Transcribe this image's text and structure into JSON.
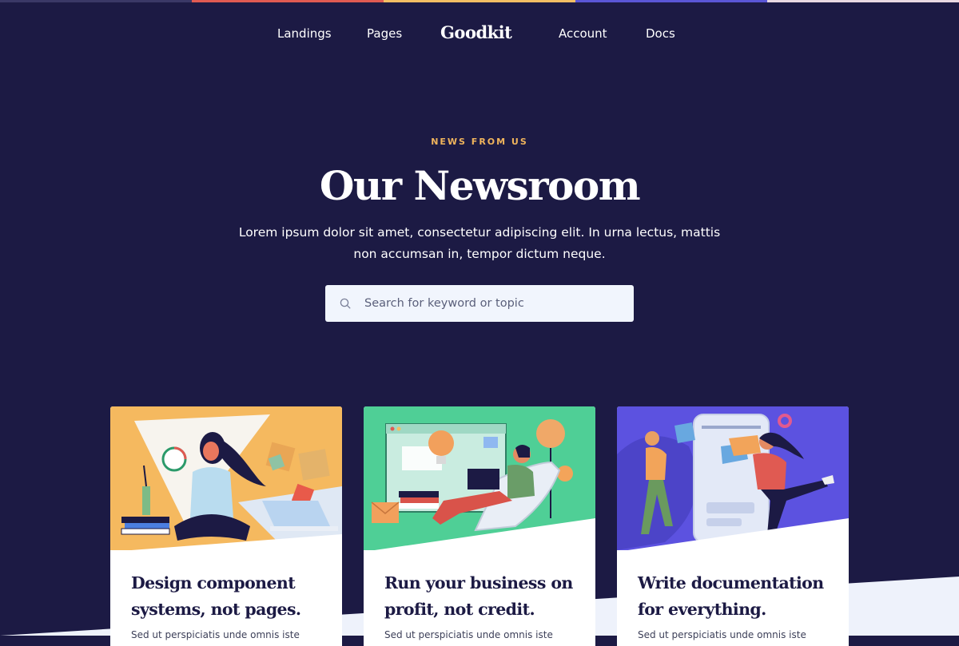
{
  "colors": {
    "background": "#1c1a44",
    "accent": "#f0b45c",
    "stripe": [
      "#3a3866",
      "#e05a52",
      "#f2be64",
      "#5a56d6",
      "#e8d8e2"
    ]
  },
  "nav": {
    "links_left": [
      "Landings",
      "Pages"
    ],
    "brand": "Goodkit",
    "links_right": [
      "Account",
      "Docs"
    ]
  },
  "hero": {
    "eyebrow": "NEWS FROM US",
    "title": "Our Newsroom",
    "subtitle": "Lorem ipsum dolor sit amet, consectetur adipiscing elit. In urna lectus, mattis non accumsan in, tempor dictum neque."
  },
  "search": {
    "icon": "search-icon",
    "placeholder": "Search for keyword or topic",
    "value": ""
  },
  "cards": [
    {
      "title": "Design component systems, not pages.",
      "excerpt": "Sed ut perspiciatis unde omnis iste",
      "illustration": "woman-meditating-illustration",
      "illustration_color": "#f5b95f"
    },
    {
      "title": "Run your business on profit, not credit.",
      "excerpt": "Sed ut perspiciatis unde omnis iste",
      "illustration": "man-with-laptop-illustration",
      "illustration_color": "#4fcf96"
    },
    {
      "title": "Write documentation for everything.",
      "excerpt": "Sed ut perspiciatis unde omnis iste",
      "illustration": "team-puzzle-illustration",
      "illustration_color": "#5c52e0"
    }
  ]
}
